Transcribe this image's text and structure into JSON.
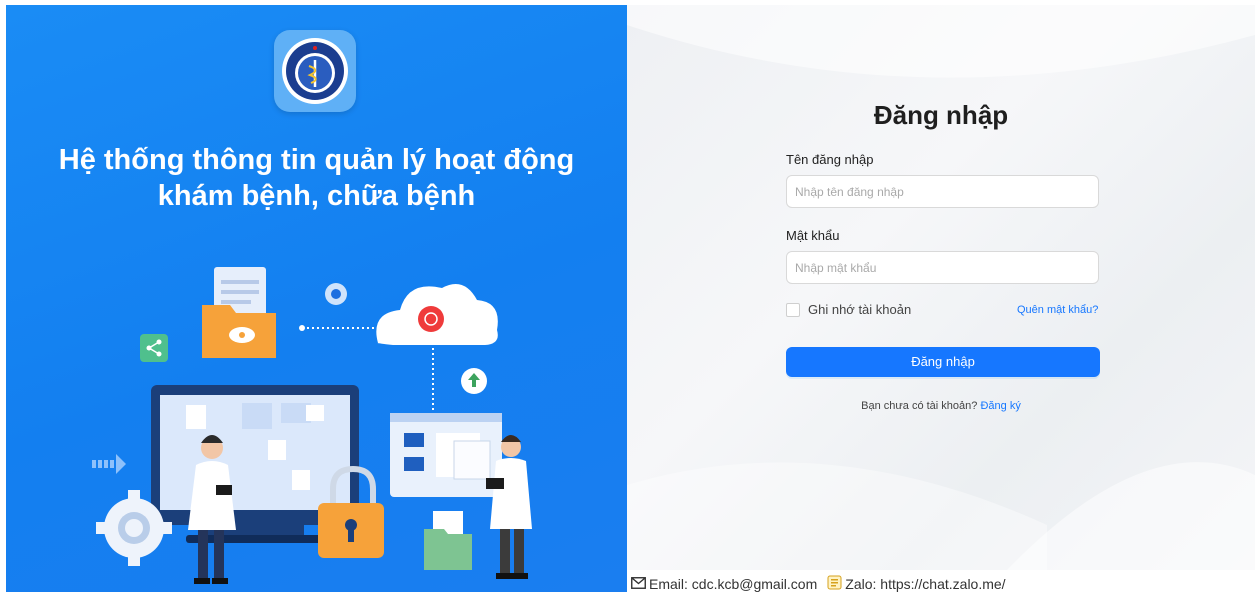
{
  "hero": {
    "logo_alt": "Bộ Y Tế - Ministry of Health",
    "headline_line1": "Hệ thống thông tin quản lý hoạt động",
    "headline_line2": "khám bệnh, chữa bệnh"
  },
  "login": {
    "title": "Đăng nhập",
    "username_label": "Tên đăng nhập",
    "username_placeholder": "Nhập tên đăng nhập",
    "username_value": "",
    "password_label": "Mật khẩu",
    "password_placeholder": "Nhập mật khẩu",
    "password_value": "",
    "remember_label": "Ghi nhớ tài khoản",
    "remember_checked": false,
    "forgot_link": "Quên mật khẩu?",
    "submit_label": "Đăng nhập",
    "signup_prompt": "Bạn chưa có tài khoản?",
    "signup_link": "Đăng ký"
  },
  "footer": {
    "email_icon": "mail-icon",
    "email_text": "Email: cdc.kcb@gmail.com",
    "zalo_icon": "zalo-icon",
    "zalo_text": "Zalo: https://chat.zalo.me/"
  },
  "colors": {
    "primary": "#1677ff",
    "hero_bg": "#137ff0",
    "folder": "#f6a23a"
  }
}
